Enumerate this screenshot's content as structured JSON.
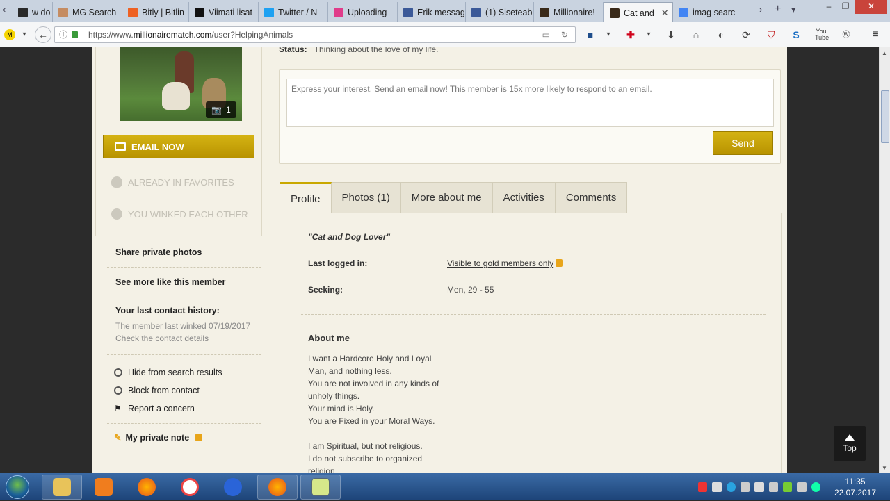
{
  "browser": {
    "tabs": [
      {
        "label": "w do I g",
        "color": "#2a2a2a"
      },
      {
        "label": "MG Search",
        "color": "#c58c62"
      },
      {
        "label": "Bitly | Bitlin",
        "color": "#ee6123"
      },
      {
        "label": "Viimati lisat",
        "color": "#111111"
      },
      {
        "label": "Twitter / N",
        "color": "#1da1f2"
      },
      {
        "label": "Uploading",
        "color": "#e03c8a"
      },
      {
        "label": "Erik messag",
        "color": "#3b5998"
      },
      {
        "label": "(1) Siseteab",
        "color": "#3b5998"
      },
      {
        "label": "Millionaire!",
        "color": "#3a2a1a"
      },
      {
        "label": "Cat and",
        "color": "#3a2a1a",
        "active": true
      },
      {
        "label": "imag searc",
        "color": "#4285f4"
      }
    ],
    "url_prefix": "https://www.",
    "url_domain": "millionairematch.com",
    "url_path": "/user?HelpingAnimals"
  },
  "left": {
    "photo_count": "1",
    "email_button": "EMAIL NOW",
    "favorites": "ALREADY IN FAVORITES",
    "winked": "YOU WINKED EACH OTHER",
    "share_photos": "Share private photos",
    "see_more": "See more like this member",
    "contact_history_title": "Your last contact history:",
    "contact_history_text": "The member last winked 07/19/2017",
    "check_contact": "Check the contact details",
    "hide": "Hide from search results",
    "block": "Block from contact",
    "report": "Report a concern",
    "private_note": "My private note"
  },
  "main": {
    "status_label": "Status:",
    "status_value": "Thinking about the love of my life.",
    "message_placeholder": "Express your interest. Send an email now! This member is 15x more likely to respond to an email.",
    "send_label": "Send",
    "tabs": [
      "Profile",
      "Photos (1)",
      "More about me",
      "Activities",
      "Comments"
    ],
    "headline": "\"Cat and Dog Lover\"",
    "last_logged_label": "Last logged in:",
    "last_logged_value": "Visible to gold members only",
    "seeking_label": "Seeking:",
    "seeking_value": "Men, 29 - 55",
    "about_title": "About me",
    "about_lines": [
      "I want a Hardcore Holy and Loyal",
      "Man, and nothing less.",
      "You are not involved in any kinds of",
      "unholy things.",
      "Your mind is Holy.",
      "You are Fixed in your Moral Ways.",
      "",
      "I am Spiritual, but not religious.",
      "I do not subscribe to organized",
      "religion."
    ],
    "top_label": "Top"
  },
  "taskbar": {
    "time": "11:35",
    "date": "22.07.2017"
  }
}
